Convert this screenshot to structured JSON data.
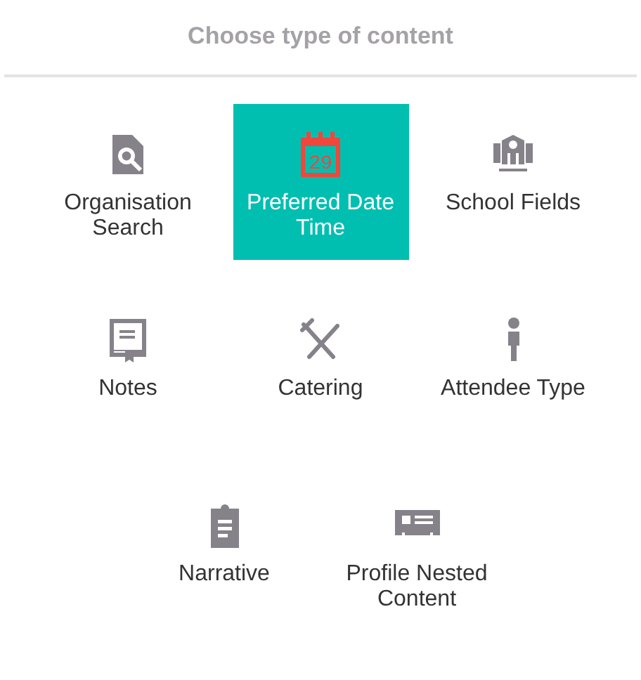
{
  "title": "Choose type of content",
  "items": [
    {
      "label": "Organisation Search",
      "selected": false
    },
    {
      "label": "Preferred Date Time",
      "selected": true,
      "icon_text": "29"
    },
    {
      "label": "School Fields",
      "selected": false
    },
    {
      "label": "Notes",
      "selected": false
    },
    {
      "label": "Catering",
      "selected": false
    },
    {
      "label": "Attendee Type",
      "selected": false
    },
    {
      "label": "Narrative",
      "selected": false
    },
    {
      "label": "Profile Nested Content",
      "selected": false
    }
  ]
}
